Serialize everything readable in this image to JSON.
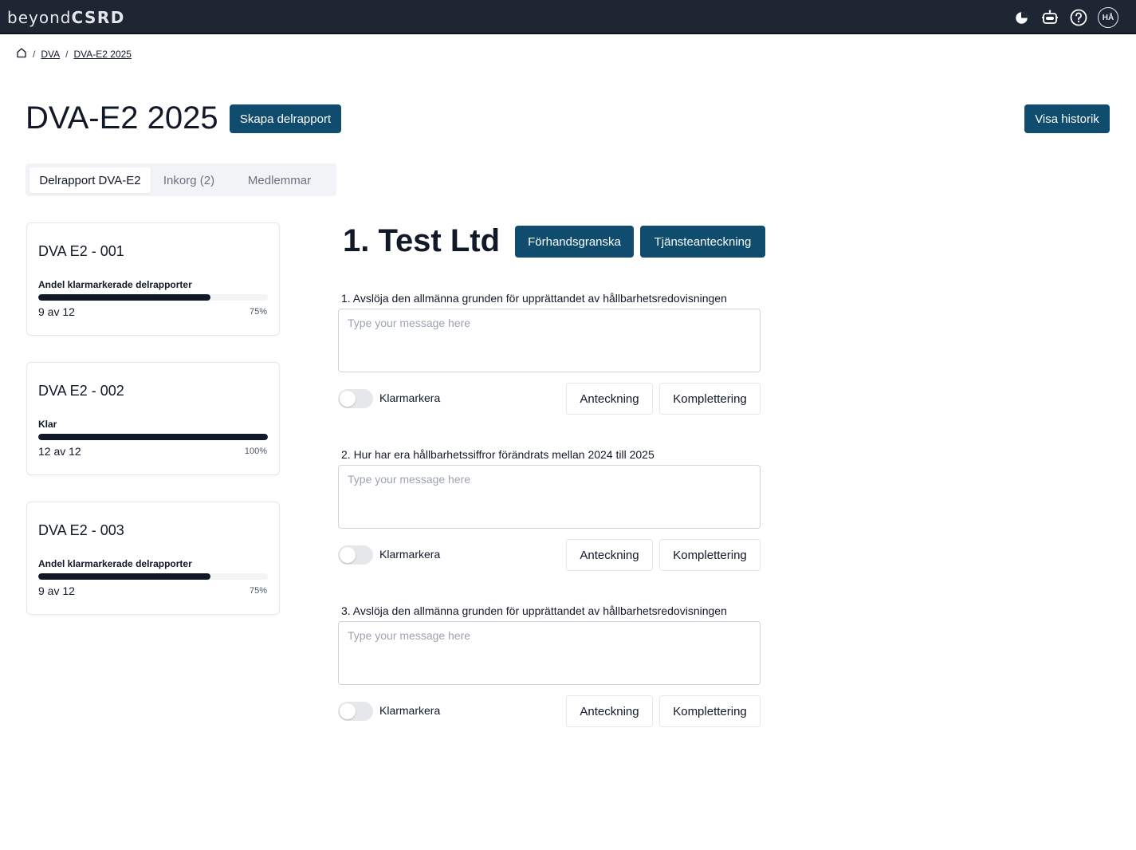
{
  "app": {
    "logo_light": "beyond",
    "logo_bold": "CSRD",
    "avatar_initials": "HÅ"
  },
  "icons": [
    "pie-chart-icon",
    "robot-icon",
    "help-icon",
    "avatar"
  ],
  "breadcrumb": {
    "home_icon": "home-icon",
    "items": [
      "DVA",
      "DVA-E2 2025"
    ]
  },
  "header": {
    "title": "DVA-E2 2025",
    "create_label": "Skapa delrapport",
    "history_label": "Visa historik"
  },
  "tabs": [
    {
      "label": "Delrapport DVA-E2",
      "active": true
    },
    {
      "label": "Inkorg (2)"
    },
    {
      "label": "Medlemmar"
    }
  ],
  "cards": [
    {
      "title": "DVA E2 - 001",
      "subtitle": "Andel klarmarkerade delrapporter",
      "count": "9 av 12",
      "percent": "75%",
      "progress": 0.75
    },
    {
      "title": "DVA E2 - 002",
      "subtitle": "Klar",
      "count": "12 av 12",
      "percent": "100%",
      "progress": 1.0
    },
    {
      "title": "DVA E2 - 003",
      "subtitle": "Andel klarmarkerade delrapporter",
      "count": "9 av 12",
      "percent": "75%",
      "progress": 0.75
    }
  ],
  "main": {
    "title": "1. Test Ltd",
    "preview_label": "Förhandsgranska",
    "note_label": "Tjänsteanteckning",
    "questions": [
      {
        "label": "1. Avslöja den allmänna grunden för upprättandet av hållbarhetsredovisningen",
        "placeholder": "Type your message here",
        "toggle_label": "Klarmarkera",
        "note_label": "Anteckning",
        "complement_label": "Komplettering"
      },
      {
        "label": "2. Hur har era hållbarhetssiffror förändrats mellan 2024 till 2025",
        "placeholder": "Type your message here",
        "toggle_label": "Klarmarkera",
        "note_label": "Anteckning",
        "complement_label": "Komplettering"
      },
      {
        "label": "3. Avslöja den allmänna grunden för upprättandet av hållbarhetsredovisningen",
        "placeholder": "Type your message here",
        "toggle_label": "Klarmarkera",
        "note_label": "Anteckning",
        "complement_label": "Komplettering"
      }
    ]
  },
  "colors": {
    "navbar": "#1e2633",
    "primary": "#0f4c6e",
    "progress": "#111827",
    "progress_track": "#f3f4f6"
  }
}
